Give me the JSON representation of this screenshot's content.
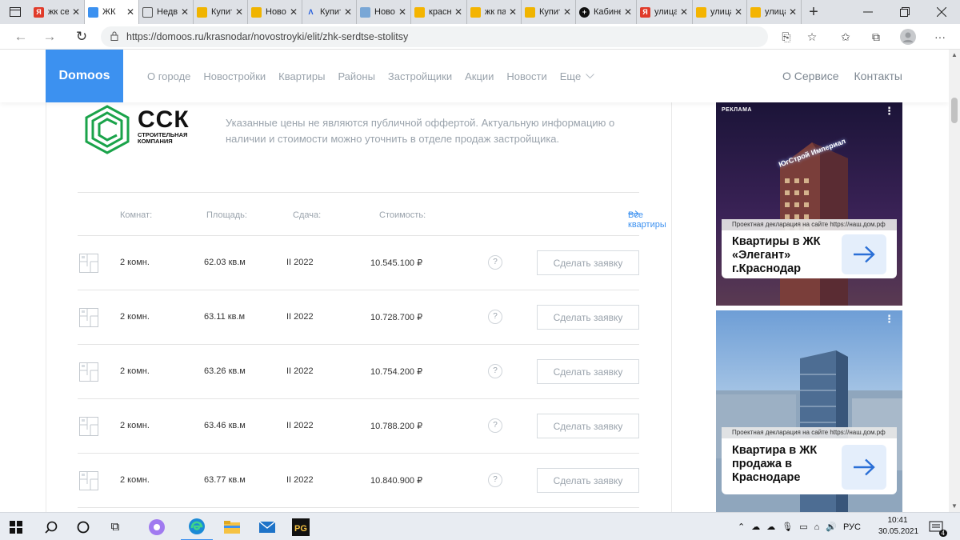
{
  "browser": {
    "tabs": [
      {
        "title": "",
        "icon": "tab-actions-icon"
      },
      {
        "title": "жк серд",
        "icon": "yandex-icon",
        "color": "#e03b2a"
      },
      {
        "title": "ЖК",
        "icon": "domoos-icon",
        "color": "#3c91f0",
        "active": true
      },
      {
        "title": "Недвиж",
        "icon": "page-icon"
      },
      {
        "title": "Купить",
        "icon": "house-icon",
        "color": "#f0b400"
      },
      {
        "title": "Новост",
        "icon": "house-icon",
        "color": "#f0b400"
      },
      {
        "title": "Купить",
        "icon": "avito-icon",
        "color": "#1a56db"
      },
      {
        "title": "Новост",
        "icon": "domoos-icon",
        "color": "#79a7d6"
      },
      {
        "title": "красна",
        "icon": "photo-icon",
        "color": "#f4b400"
      },
      {
        "title": "жк пан",
        "icon": "photo-icon",
        "color": "#f4b400"
      },
      {
        "title": "Купить",
        "icon": "house-icon",
        "color": "#f0b400"
      },
      {
        "title": "Кабине",
        "icon": "plus-circle-icon",
        "color": "#111"
      },
      {
        "title": "улица к",
        "icon": "yandex-icon",
        "color": "#e03b2a"
      },
      {
        "title": "улица к",
        "icon": "photo-icon",
        "color": "#f4b400"
      },
      {
        "title": "улица к",
        "icon": "photo-icon",
        "color": "#f4b400"
      }
    ],
    "new_tab": "+",
    "url": "https://domoos.ru/krasnodar/novostroyki/elit/zhk-serdtse-stolitsy"
  },
  "header": {
    "logo": "Domoos",
    "nav": [
      "О городе",
      "Новостройки",
      "Квартиры",
      "Районы",
      "Застройщики",
      "Акции",
      "Новости",
      "Еще"
    ],
    "right": [
      "О Сервисе",
      "Контакты"
    ]
  },
  "developer": {
    "logo_big": "ССК",
    "logo_small_1": "СТРОИТЕЛЬНАЯ",
    "logo_small_2": "КОМПАНИЯ",
    "notice": "Указанные цены не являются публичной оффертой. Актуальную информацию о наличии и стоимости можно уточнить в отделе продаж застройщика."
  },
  "table": {
    "headers": [
      "Комнат:",
      "Площадь:",
      "Сдача:",
      "Стоимость:"
    ],
    "all_link": "Все квартиры",
    "rows": [
      {
        "rooms": "2 комн.",
        "area": "62.03 кв.м",
        "term": "II 2022",
        "price": "10.545.100 ₽"
      },
      {
        "rooms": "2 комн.",
        "area": "63.11 кв.м",
        "term": "II 2022",
        "price": "10.728.700 ₽"
      },
      {
        "rooms": "2 комн.",
        "area": "63.26 кв.м",
        "term": "II 2022",
        "price": "10.754.200 ₽"
      },
      {
        "rooms": "2 комн.",
        "area": "63.46 кв.м",
        "term": "II 2022",
        "price": "10.788.200 ₽"
      },
      {
        "rooms": "2 комн.",
        "area": "63.77 кв.м",
        "term": "II 2022",
        "price": "10.840.900 ₽"
      }
    ],
    "help": "?",
    "button": "Сделать заявку"
  },
  "ads": [
    {
      "label": "РЕКЛАМА",
      "declaration": "Проектная декларация на сайте https://наш.дом.рф",
      "title": "Квартиры в ЖК «Элегант» г.Краснодар",
      "building_sign": "ЮгСтрой Империал"
    },
    {
      "label": "",
      "declaration": "Проектная декларация на сайте https://наш.дом.рф",
      "title": "Квартира в ЖК продажа в Краснодаре"
    }
  ],
  "taskbar": {
    "lang": "РУС",
    "time": "10:41",
    "date": "30.05.2021",
    "notifications": "4"
  },
  "colors": {
    "accent": "#3c91f0",
    "ssk_green": "#1aa34a"
  }
}
